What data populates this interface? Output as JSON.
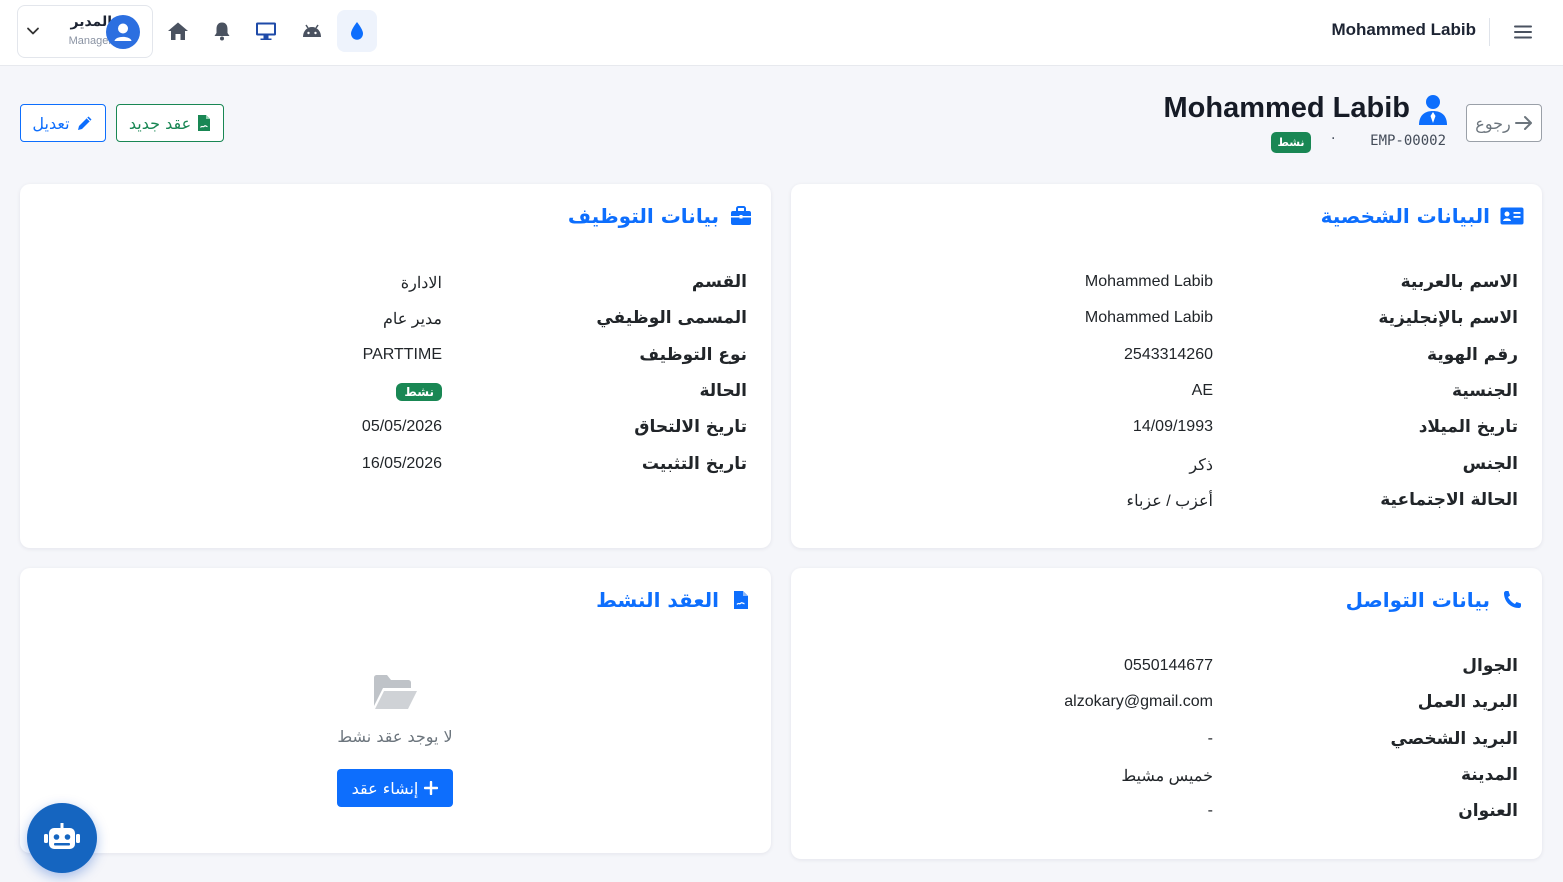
{
  "navbar": {
    "brand": "Mohammed Labib",
    "user": {
      "name": "المدير",
      "role": "Manager"
    },
    "icons": [
      "home-icon",
      "bell-icon",
      "monitor-icon",
      "android-icon",
      "droplet-icon"
    ],
    "active_icon": "droplet-icon"
  },
  "header": {
    "back_label": "رجوع",
    "employee_name": "Mohammed Labib",
    "employee_code": "EMP-00002",
    "separator": "·",
    "status": "نشط",
    "new_contract_label": "عقد جديد",
    "edit_label": "تعديل"
  },
  "personal": {
    "title": "البيانات الشخصية",
    "rows": [
      {
        "label": "الاسم بالعربية",
        "value": "Mohammed Labib"
      },
      {
        "label": "الاسم بالإنجليزية",
        "value": "Mohammed Labib"
      },
      {
        "label": "رقم الهوية",
        "value": "2543314260"
      },
      {
        "label": "الجنسية",
        "value": "AE"
      },
      {
        "label": "تاريخ الميلاد",
        "value": "14/09/1993"
      },
      {
        "label": "الجنس",
        "value": "ذكر"
      },
      {
        "label": "الحالة الاجتماعية",
        "value": "أعزب / عزباء"
      }
    ]
  },
  "employment": {
    "title": "بيانات التوظيف",
    "rows": [
      {
        "label": "القسم",
        "value": "الادارة"
      },
      {
        "label": "المسمى الوظيفي",
        "value": "مدير عام"
      },
      {
        "label": "نوع التوظيف",
        "value": "PARTTIME"
      },
      {
        "label": "الحالة",
        "value": "نشط"
      },
      {
        "label": "تاريخ الالتحاق",
        "value": "05/05/2026"
      },
      {
        "label": "تاريخ التثبيت",
        "value": "16/05/2026"
      }
    ]
  },
  "contact": {
    "title": "بيانات التواصل",
    "rows": [
      {
        "label": "الجوال",
        "value": "0550144677"
      },
      {
        "label": "البريد العمل",
        "value": "alzokary@gmail.com"
      },
      {
        "label": "البريد الشخصي",
        "value": "-"
      },
      {
        "label": "المدينة",
        "value": "خميس مشيط"
      },
      {
        "label": "العنوان",
        "value": "-"
      }
    ]
  },
  "contract": {
    "title": "العقد النشط",
    "empty_text": "لا يوجد عقد نشط",
    "create_label": "إنشاء عقد"
  },
  "colors": {
    "primary": "#0d6efd",
    "success": "#198754",
    "bot": "#1565c0"
  }
}
